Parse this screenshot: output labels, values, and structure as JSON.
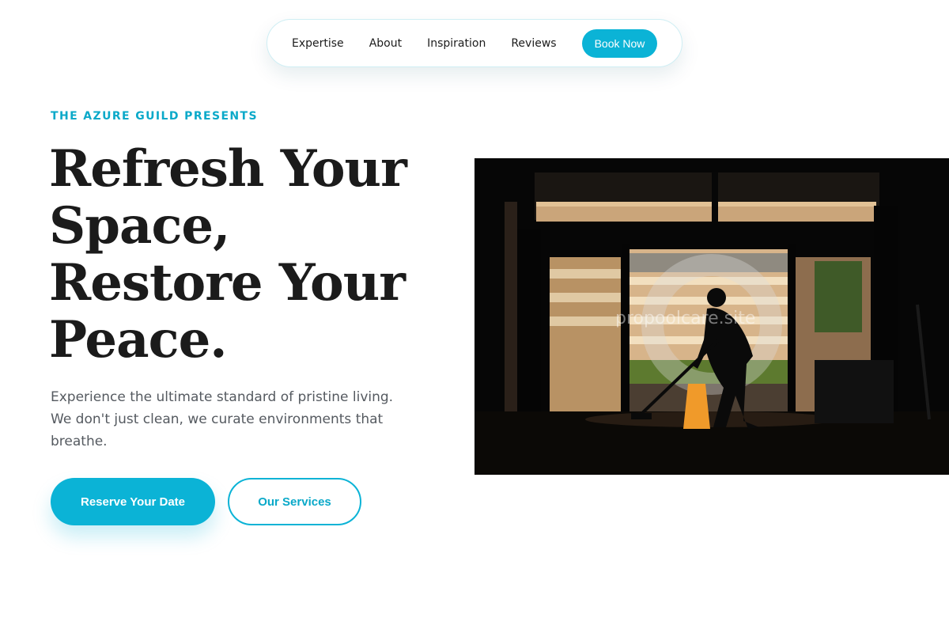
{
  "nav": {
    "links": [
      "Expertise",
      "About",
      "Inspiration",
      "Reviews"
    ],
    "book_label": "Book Now"
  },
  "hero": {
    "eyebrow": "THE AZURE GUILD PRESENTS",
    "headline_lines": [
      "Refresh Your",
      "Space,",
      "Restore Your",
      "Peace."
    ],
    "subcopy": "Experience the ultimate standard of pristine living. We don't just clean, we curate environments that breathe.",
    "primary_cta": "Reserve Your Date",
    "secondary_cta": "Our Services",
    "image_watermark": "propoolcare.site"
  },
  "colors": {
    "accent": "#0bb3d6",
    "heading": "#1b1b1b",
    "body_text": "#555a60"
  }
}
